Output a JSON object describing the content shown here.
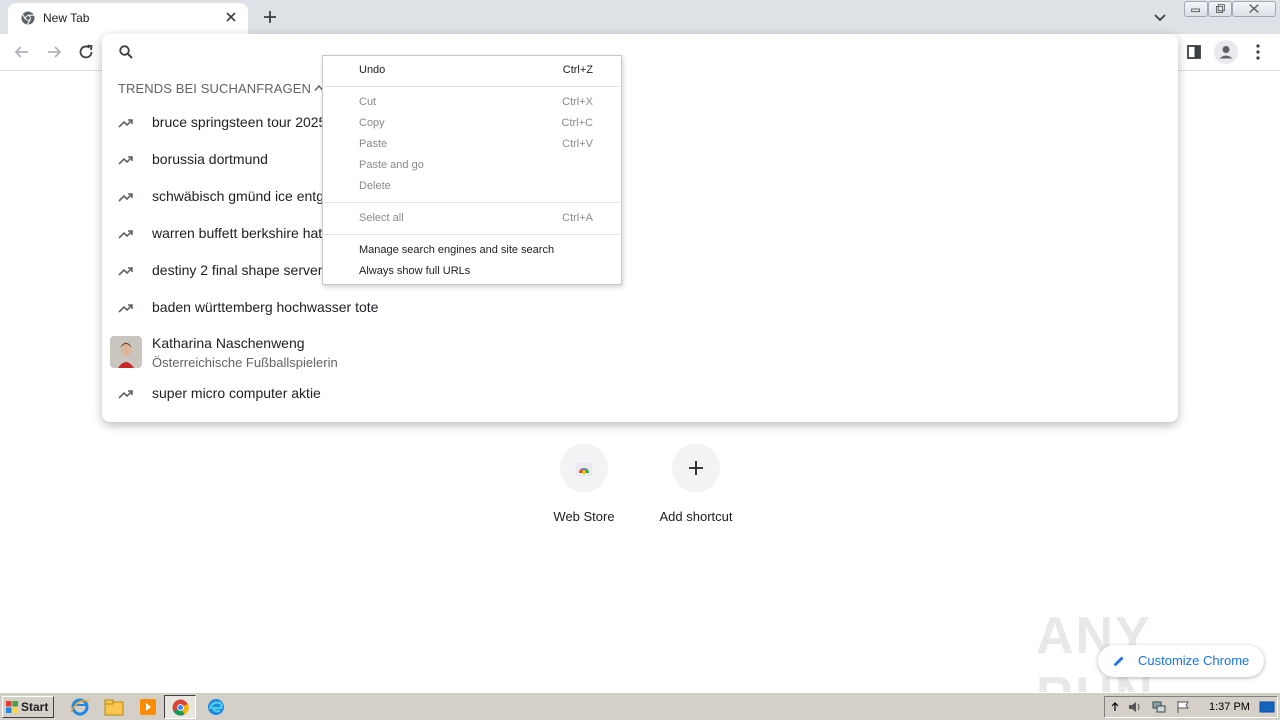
{
  "browser": {
    "tab_title": "New Tab",
    "omnibox_placeholder": ""
  },
  "omnibox": {
    "trends_header": "TRENDS BEI SUCHANFRAGEN",
    "suggestions": [
      "bruce springsteen tour 2025",
      "borussia dortmund",
      "schwäbisch gmünd ice entg",
      "warren buffett berkshire hat",
      "destiny 2 final shape server",
      "baden württemberg hochwasser tote"
    ],
    "entity": {
      "title": "Katharina Naschenweng",
      "subtitle": "Österreichische Fußballspielerin"
    },
    "last_suggestion": "super micro computer aktie"
  },
  "context_menu": {
    "undo": {
      "label": "Undo",
      "shortcut": "Ctrl+Z"
    },
    "cut": {
      "label": "Cut",
      "shortcut": "Ctrl+X"
    },
    "copy": {
      "label": "Copy",
      "shortcut": "Ctrl+C"
    },
    "paste": {
      "label": "Paste",
      "shortcut": "Ctrl+V"
    },
    "paste_and_go": {
      "label": "Paste and go"
    },
    "delete": {
      "label": "Delete"
    },
    "select_all": {
      "label": "Select all",
      "shortcut": "Ctrl+A"
    },
    "manage_search": {
      "label": "Manage search engines and site search"
    },
    "show_full_urls": {
      "label": "Always show full URLs"
    }
  },
  "ntp": {
    "shortcuts": [
      {
        "label": "Web Store",
        "icon": "webstore-icon"
      },
      {
        "label": "Add shortcut",
        "icon": "plus-icon"
      }
    ],
    "customize_label": "Customize Chrome"
  },
  "watermark": "ANY RUN",
  "taskbar": {
    "start_label": "Start",
    "clock": "1:37 PM"
  },
  "colors": {
    "accent": "#1a73e8",
    "tabstrip": "#dee1e6",
    "taskbar": "#d4d0c8"
  }
}
